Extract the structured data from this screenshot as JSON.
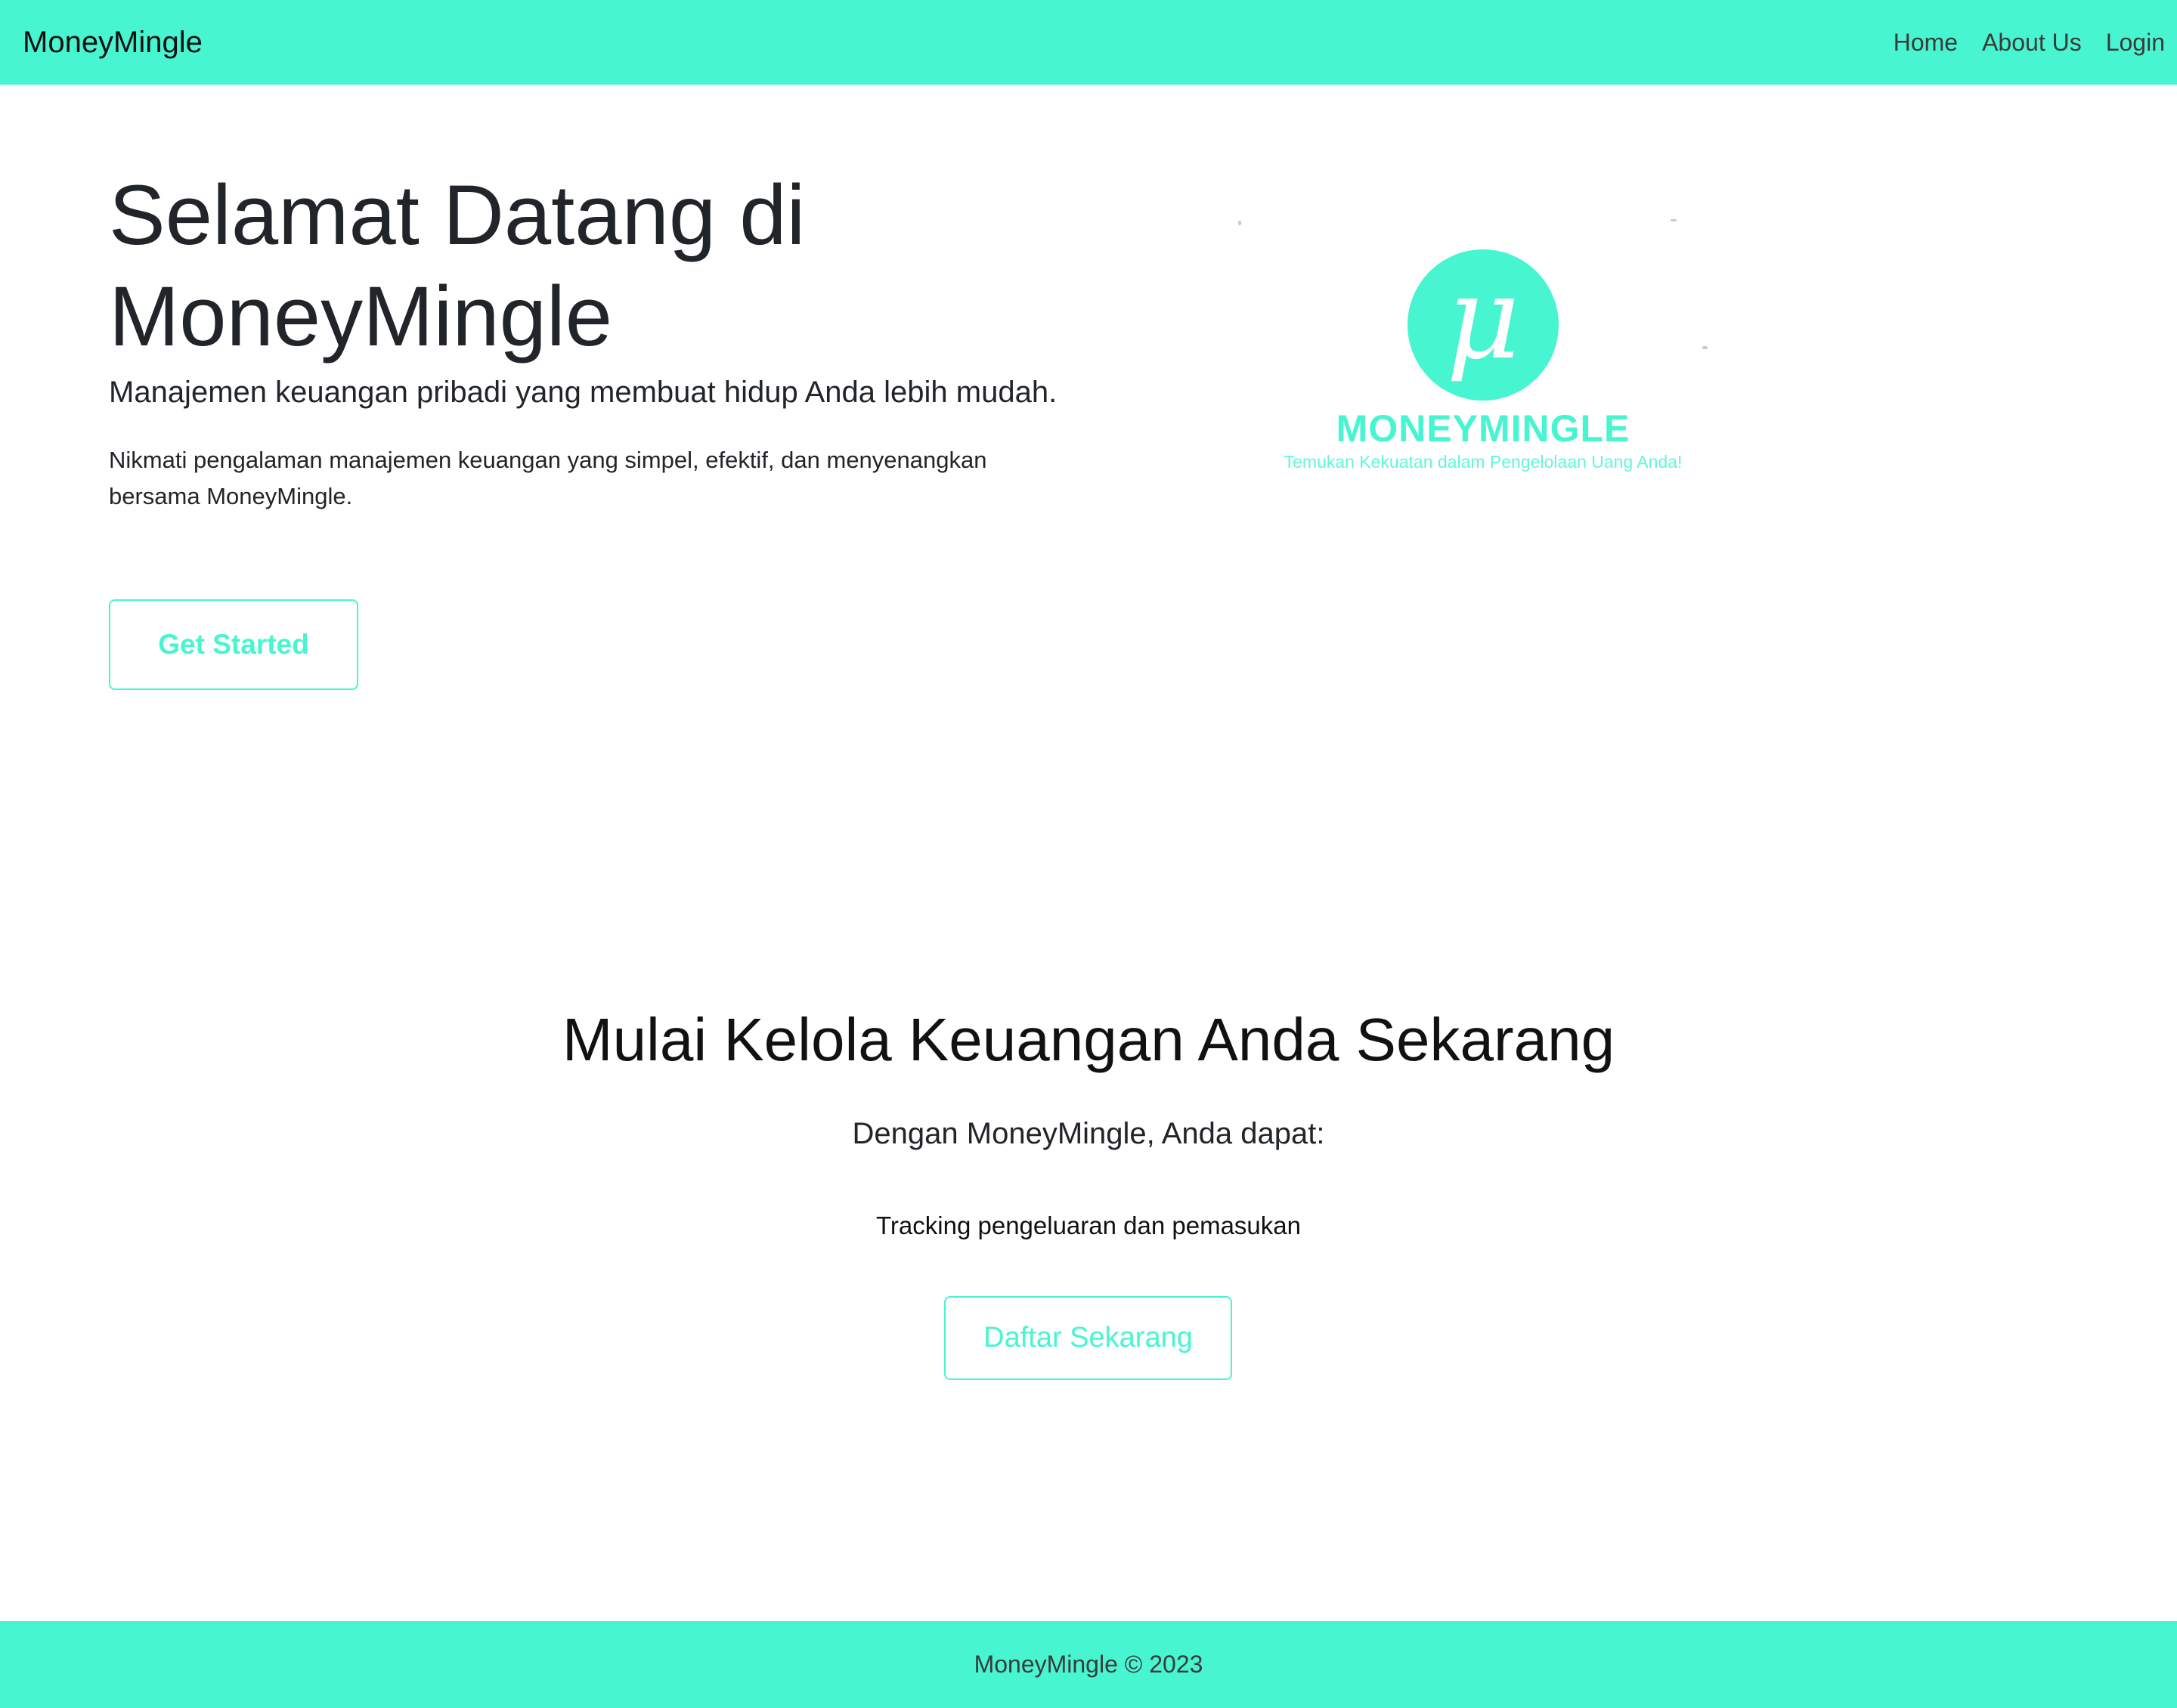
{
  "colors": {
    "accent": "#47f5d1",
    "text": "#212529"
  },
  "navbar": {
    "brand": "MoneyMingle",
    "links": [
      {
        "label": "Home"
      },
      {
        "label": "About Us"
      },
      {
        "label": "Login"
      }
    ]
  },
  "hero": {
    "title": "Selamat Datang di MoneyMingle",
    "lead": "Manajemen keuangan pribadi yang membuat hidup Anda lebih mudah.",
    "description": "Nikmati pengalaman manajemen keuangan yang simpel, efektif, dan menyenangkan bersama MoneyMingle.",
    "cta_label": "Get Started"
  },
  "logo": {
    "glyph": "μ",
    "wordmark": "MONEYMINGLE",
    "tagline": "Temukan Kekuatan dalam  Pengelolaan Uang Anda!"
  },
  "cta_section": {
    "title": "Mulai Kelola Keuangan Anda Sekarang",
    "lead": "Dengan MoneyMingle, Anda dapat:",
    "features": [
      "Tracking pengeluaran dan pemasukan"
    ],
    "button_label": "Daftar Sekarang"
  },
  "footer": {
    "text": "MoneyMingle © 2023"
  }
}
